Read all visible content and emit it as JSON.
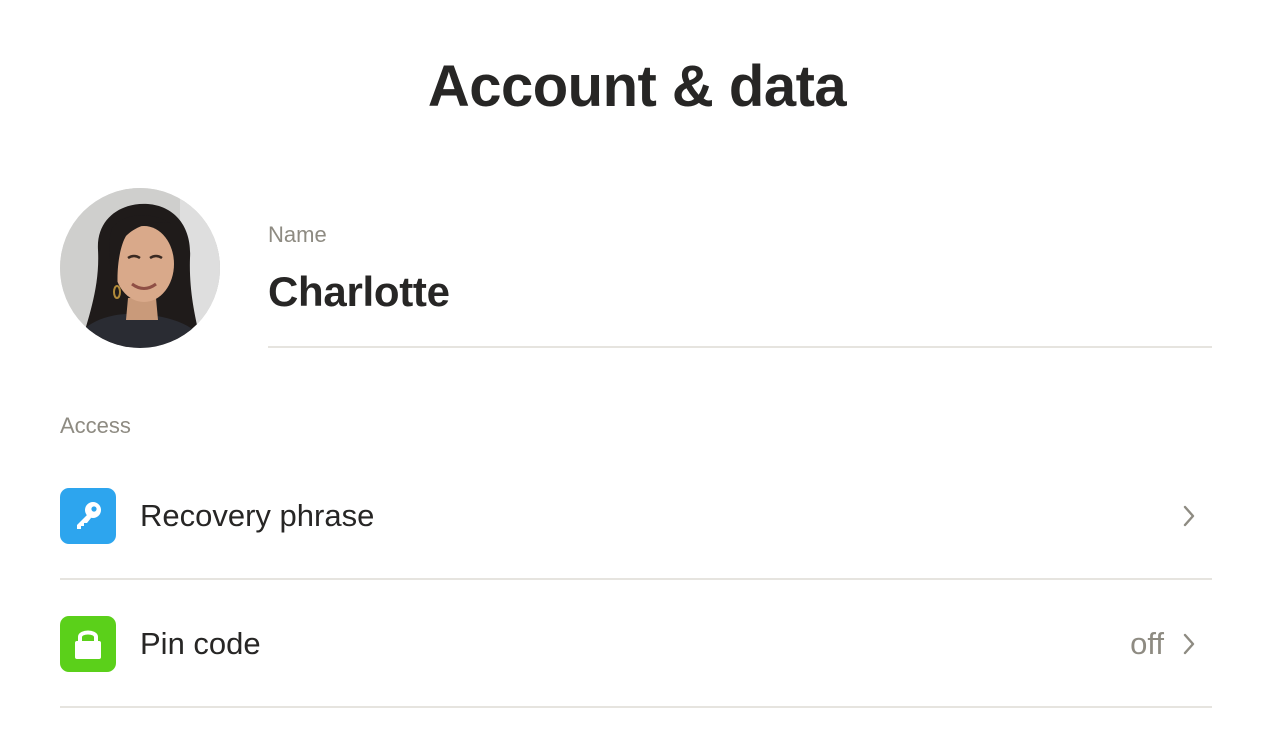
{
  "header": {
    "title": "Account & data"
  },
  "profile": {
    "avatar_icon": "user-photo",
    "name_label": "Name",
    "name_value": "Charlotte"
  },
  "access": {
    "section_label": "Access",
    "items": [
      {
        "label": "Recovery phrase",
        "value": "",
        "icon": "key-icon",
        "icon_color": "#2da5ee",
        "chevron_icon": "chevron-right-icon"
      },
      {
        "label": "Pin code",
        "value": "off",
        "icon": "lock-icon",
        "icon_color": "#5bd01a",
        "chevron_icon": "chevron-right-icon"
      }
    ]
  },
  "colors": {
    "text_primary": "#272625",
    "text_secondary": "#8e8b82",
    "divider": "#e6e4df"
  }
}
